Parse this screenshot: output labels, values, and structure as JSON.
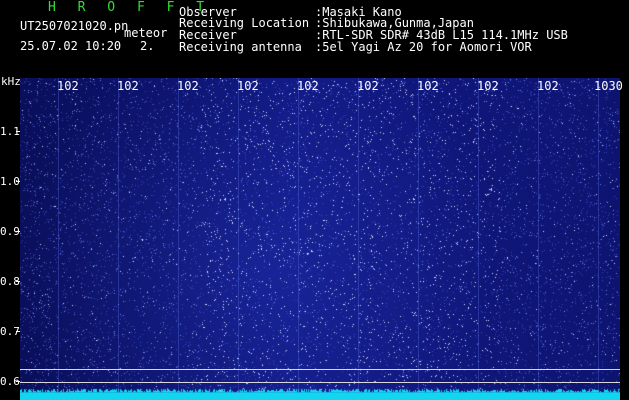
{
  "app": {
    "brand": "H R O F F T"
  },
  "file": {
    "name": "UT2507021020.pn",
    "tag": "meteor",
    "date_time": "25.07.02 10:20",
    "extra": "2."
  },
  "station": {
    "observer_label": "Observer",
    "observer_value": ":Masaki Kano",
    "location_label": "Receiving Location",
    "location_value": ":Shibukawa,Gunma,Japan",
    "receiver_label": "Receiver",
    "receiver_value": ":RTL-SDR SDR# 43dB L15 114.1MHz USB",
    "antenna_label": "Receiving antenna",
    "antenna_value": ":5el Yagi Az 20 for Aomori VOR"
  },
  "spectrogram": {
    "y_unit": "kHz",
    "y_ticks": [
      "1.1",
      "1.0",
      "0.9",
      "0.8",
      "0.7",
      "0.6"
    ],
    "x_ticks": [
      "102",
      "102",
      "102",
      "102",
      "102",
      "102",
      "102",
      "102",
      "102",
      "1030"
    ],
    "colors": {
      "background": "#0c1270",
      "speckle": "#9fb0ff",
      "baseline": "#12d6f0",
      "markers": "#d8d8d8"
    }
  }
}
